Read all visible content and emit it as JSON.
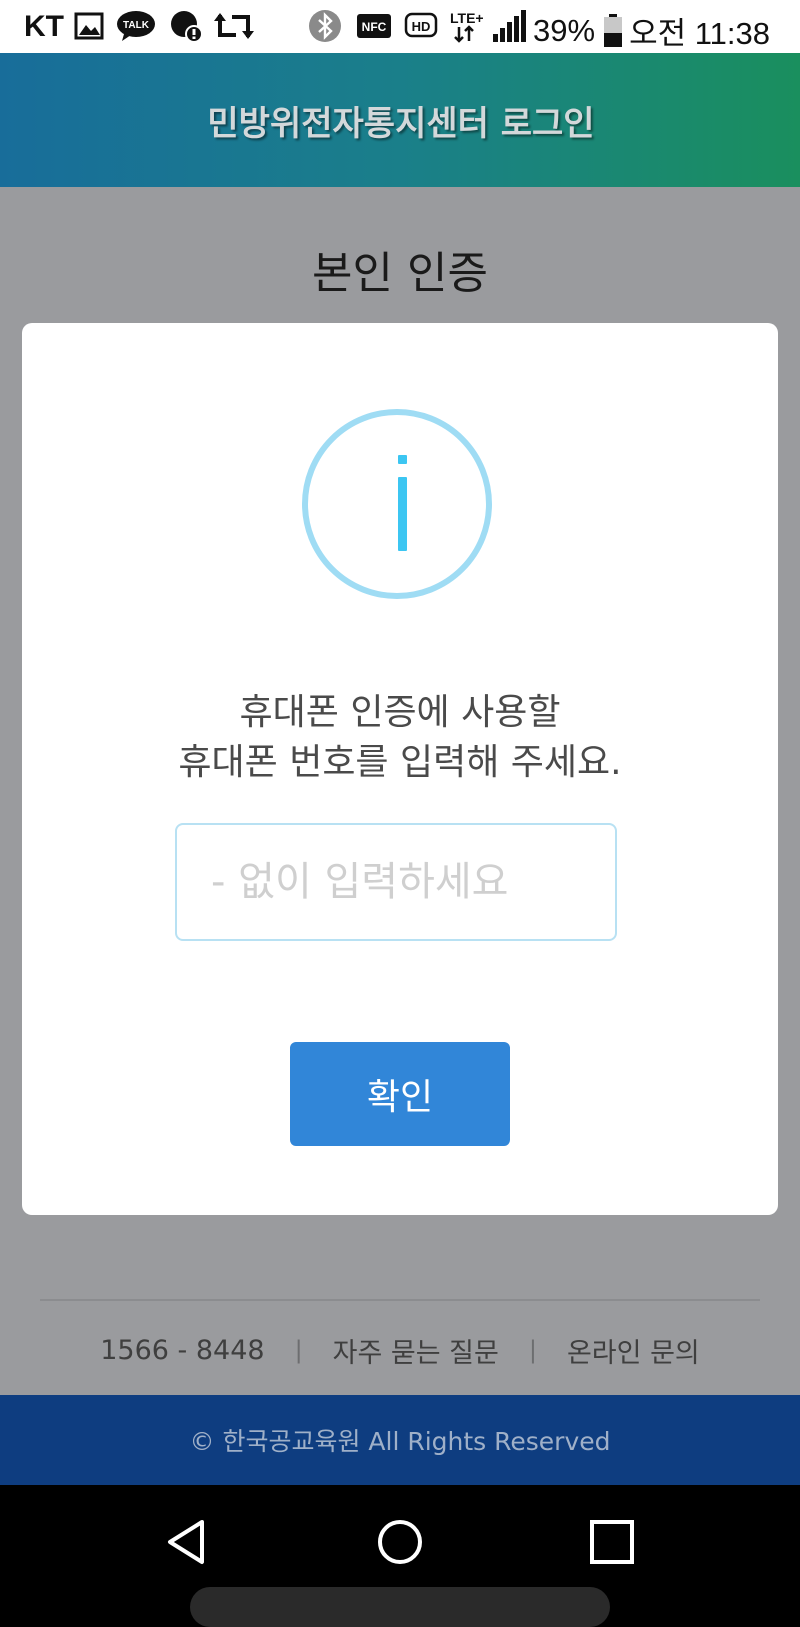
{
  "status_bar": {
    "carrier": "KT",
    "icons": [
      "gallery-icon",
      "kakaotalk-icon",
      "alert-icon",
      "retweet-icon",
      "bluetooth-icon",
      "nfc-icon",
      "hd-icon",
      "lte-icon",
      "signal-icon",
      "battery-icon"
    ],
    "talk_label": "TALK",
    "nfc_label": "NFC",
    "hd_label": "HD",
    "lte_label": "LTE+",
    "battery": "39%",
    "time": "오전 11:38"
  },
  "header": {
    "title": "민방위전자통지센터 로그인"
  },
  "page": {
    "heading": "본인 인증"
  },
  "dialog": {
    "icon": "info-icon",
    "message_line1": "휴대폰 인증에 사용할",
    "message_line2": "휴대폰 번호를 입력해 주세요.",
    "input_value": "",
    "input_placeholder": "- 없이 입력하세요",
    "confirm_label": "확인"
  },
  "footer": {
    "phone": "1566 - 8448",
    "separator": "|",
    "faq": "자주 묻는 질문",
    "inquiry": "온라인 문의",
    "copyright": "© 한국공교육원 All Rights Reserved"
  },
  "colors": {
    "header_gradient_start": "#186d9a",
    "header_gradient_end": "#1a8f5e",
    "page_background": "#9a9b9e",
    "confirm_button": "#3186d8",
    "info_icon": "#3cc6f2",
    "copyright_bar": "#0e3d80"
  },
  "nav_bar": {
    "buttons": [
      "back-icon",
      "home-icon",
      "recents-icon"
    ]
  }
}
